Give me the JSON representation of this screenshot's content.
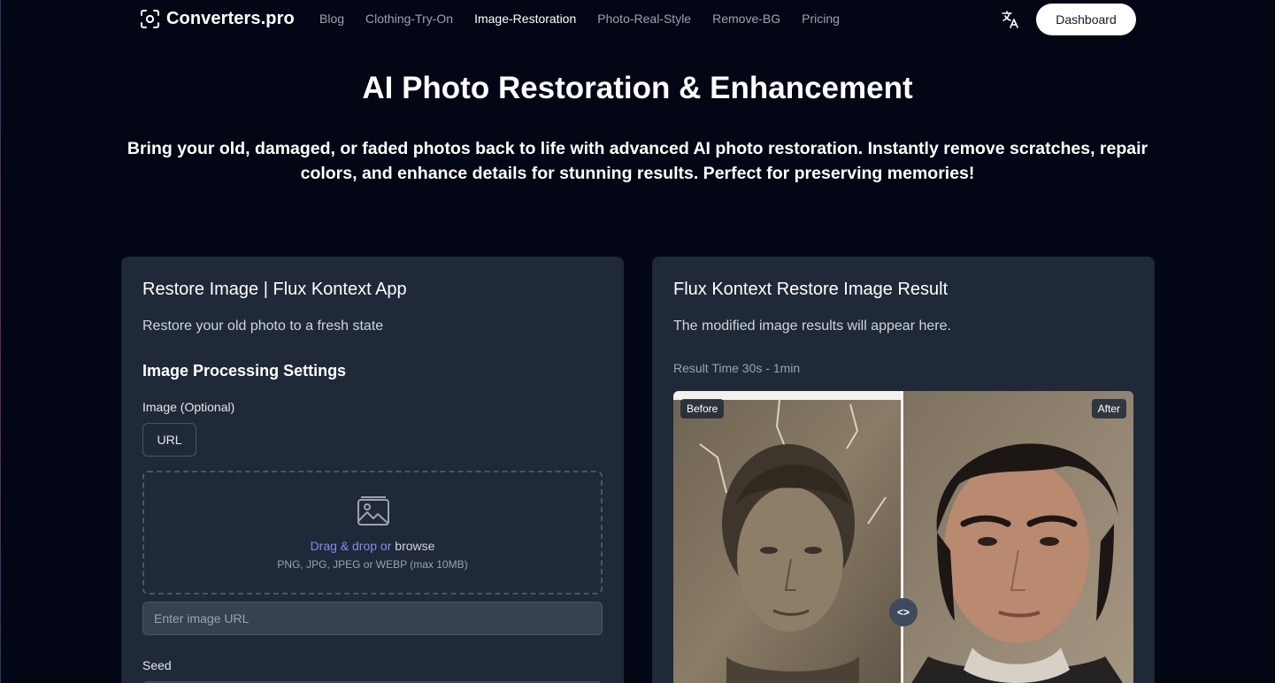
{
  "header": {
    "logo_text": "Converters.pro",
    "nav": [
      {
        "label": "Blog",
        "active": false
      },
      {
        "label": "Clothing-Try-On",
        "active": false
      },
      {
        "label": "Image-Restoration",
        "active": true
      },
      {
        "label": "Photo-Real-Style",
        "active": false
      },
      {
        "label": "Remove-BG",
        "active": false
      },
      {
        "label": "Pricing",
        "active": false
      }
    ],
    "translate_icon": "translate-icon",
    "dashboard_label": "Dashboard"
  },
  "hero": {
    "title": "AI Photo Restoration & Enhancement",
    "subtitle": "Bring your old, damaged, or faded photos back to life with advanced AI photo restoration. Instantly remove scratches, repair colors, and enhance details for stunning results. Perfect for preserving memories!"
  },
  "left_card": {
    "title": "Restore Image | Flux Kontext App",
    "description": "Restore your old photo to a fresh state",
    "settings_title": "Image Processing Settings",
    "image_label": "Image (Optional)",
    "url_button": "URL",
    "dropzone": {
      "icon": "image-icon",
      "drag_text": "Drag & drop or",
      "browse_text": "browse",
      "formats": "PNG, JPG, JPEG or WEBP (max 10MB)"
    },
    "url_input_placeholder": "Enter image URL",
    "url_input_value": "",
    "seed_label": "Seed"
  },
  "right_card": {
    "title": "Flux Kontext Restore Image Result",
    "description": "The modified image results will appear here.",
    "result_time": "Result Time 30s - 1min",
    "before_label": "Before",
    "after_label": "After",
    "slider_position": 0.5,
    "handle_glyph": "<>"
  },
  "colors": {
    "background": "#030614",
    "card": "#1f2937",
    "accent_link": "#818cf8"
  }
}
